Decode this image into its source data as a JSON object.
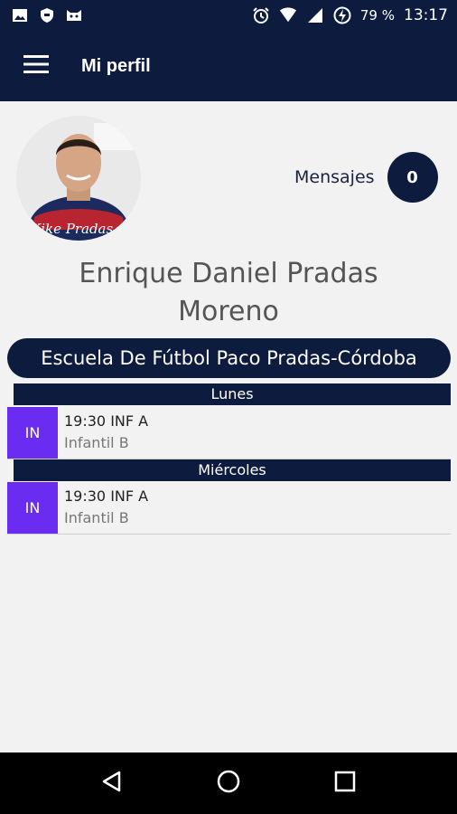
{
  "status_bar": {
    "battery": "79 %",
    "time": "13:17"
  },
  "app_bar": {
    "title": "Mi perfil"
  },
  "profile": {
    "avatar_caption": "Kike Pradas",
    "messages_label": "Mensajes",
    "messages_count": "0",
    "name": "Enrique Daniel Pradas Moreno",
    "club": "Escuela De Fútbol Paco Pradas-Córdoba"
  },
  "schedule": [
    {
      "day": "Lunes",
      "sessions": [
        {
          "badge": "IN",
          "time": "19:30 INF A",
          "group": "Infantil B"
        }
      ]
    },
    {
      "day": "Miércoles",
      "sessions": [
        {
          "badge": "IN",
          "time": "19:30 INF A",
          "group": "Infantil B"
        }
      ]
    }
  ],
  "colors": {
    "primary": "#0d1b3e",
    "badge": "#6a2cf0",
    "background": "#f2f2f2"
  }
}
